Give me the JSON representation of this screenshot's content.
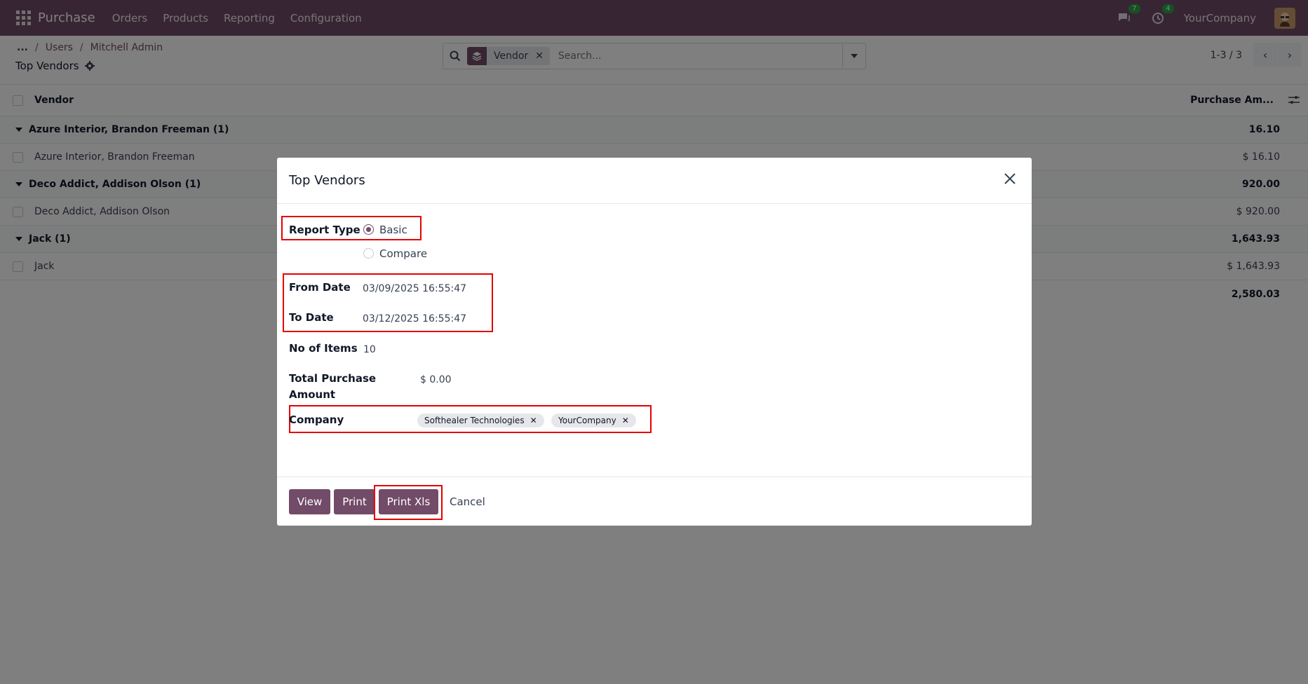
{
  "navbar": {
    "app_name": "Purchase",
    "menus": [
      "Orders",
      "Products",
      "Reporting",
      "Configuration"
    ],
    "messages_count": "7",
    "activities_count": "4",
    "company": "YourCompany"
  },
  "control_panel": {
    "breadcrumb_more": "...",
    "breadcrumbs": [
      "Users",
      "Mitchell Admin"
    ],
    "title": "Top Vendors",
    "search_facet": "Vendor",
    "search_placeholder": "Search...",
    "pager": "1-3 / 3"
  },
  "list": {
    "col_vendor": "Vendor",
    "col_amount": "Purchase Am...",
    "groups": [
      {
        "name": "Azure Interior, Brandon Freeman (1)",
        "total": "16.10",
        "row_name": "Azure Interior, Brandon Freeman",
        "row_amount": "$ 16.10"
      },
      {
        "name": "Deco Addict, Addison Olson (1)",
        "total": "920.00",
        "row_name": "Deco Addict, Addison Olson",
        "row_amount": "$ 920.00"
      },
      {
        "name": "Jack (1)",
        "total": "1,643.93",
        "row_name": "Jack",
        "row_amount": "$ 1,643.93"
      }
    ],
    "grand_total": "2,580.03"
  },
  "dialog": {
    "title": "Top Vendors",
    "report_type_label": "Report Type",
    "option_basic": "Basic",
    "option_compare": "Compare",
    "from_date_label": "From Date",
    "from_date": "03/09/2025 16:55:47",
    "to_date_label": "To Date",
    "to_date": "03/12/2025 16:55:47",
    "no_items_label": "No of Items",
    "no_items": "10",
    "total_label_1": "Total Purchase",
    "total_label_2": "Amount",
    "total_value": "$ 0.00",
    "company_label": "Company",
    "companies": [
      "Softhealer Technologies",
      "YourCompany"
    ],
    "btn_view": "View",
    "btn_print": "Print",
    "btn_print_xls": "Print Xls",
    "btn_cancel": "Cancel"
  },
  "colors": {
    "brand": "#714B67",
    "highlight": "#e60000"
  }
}
